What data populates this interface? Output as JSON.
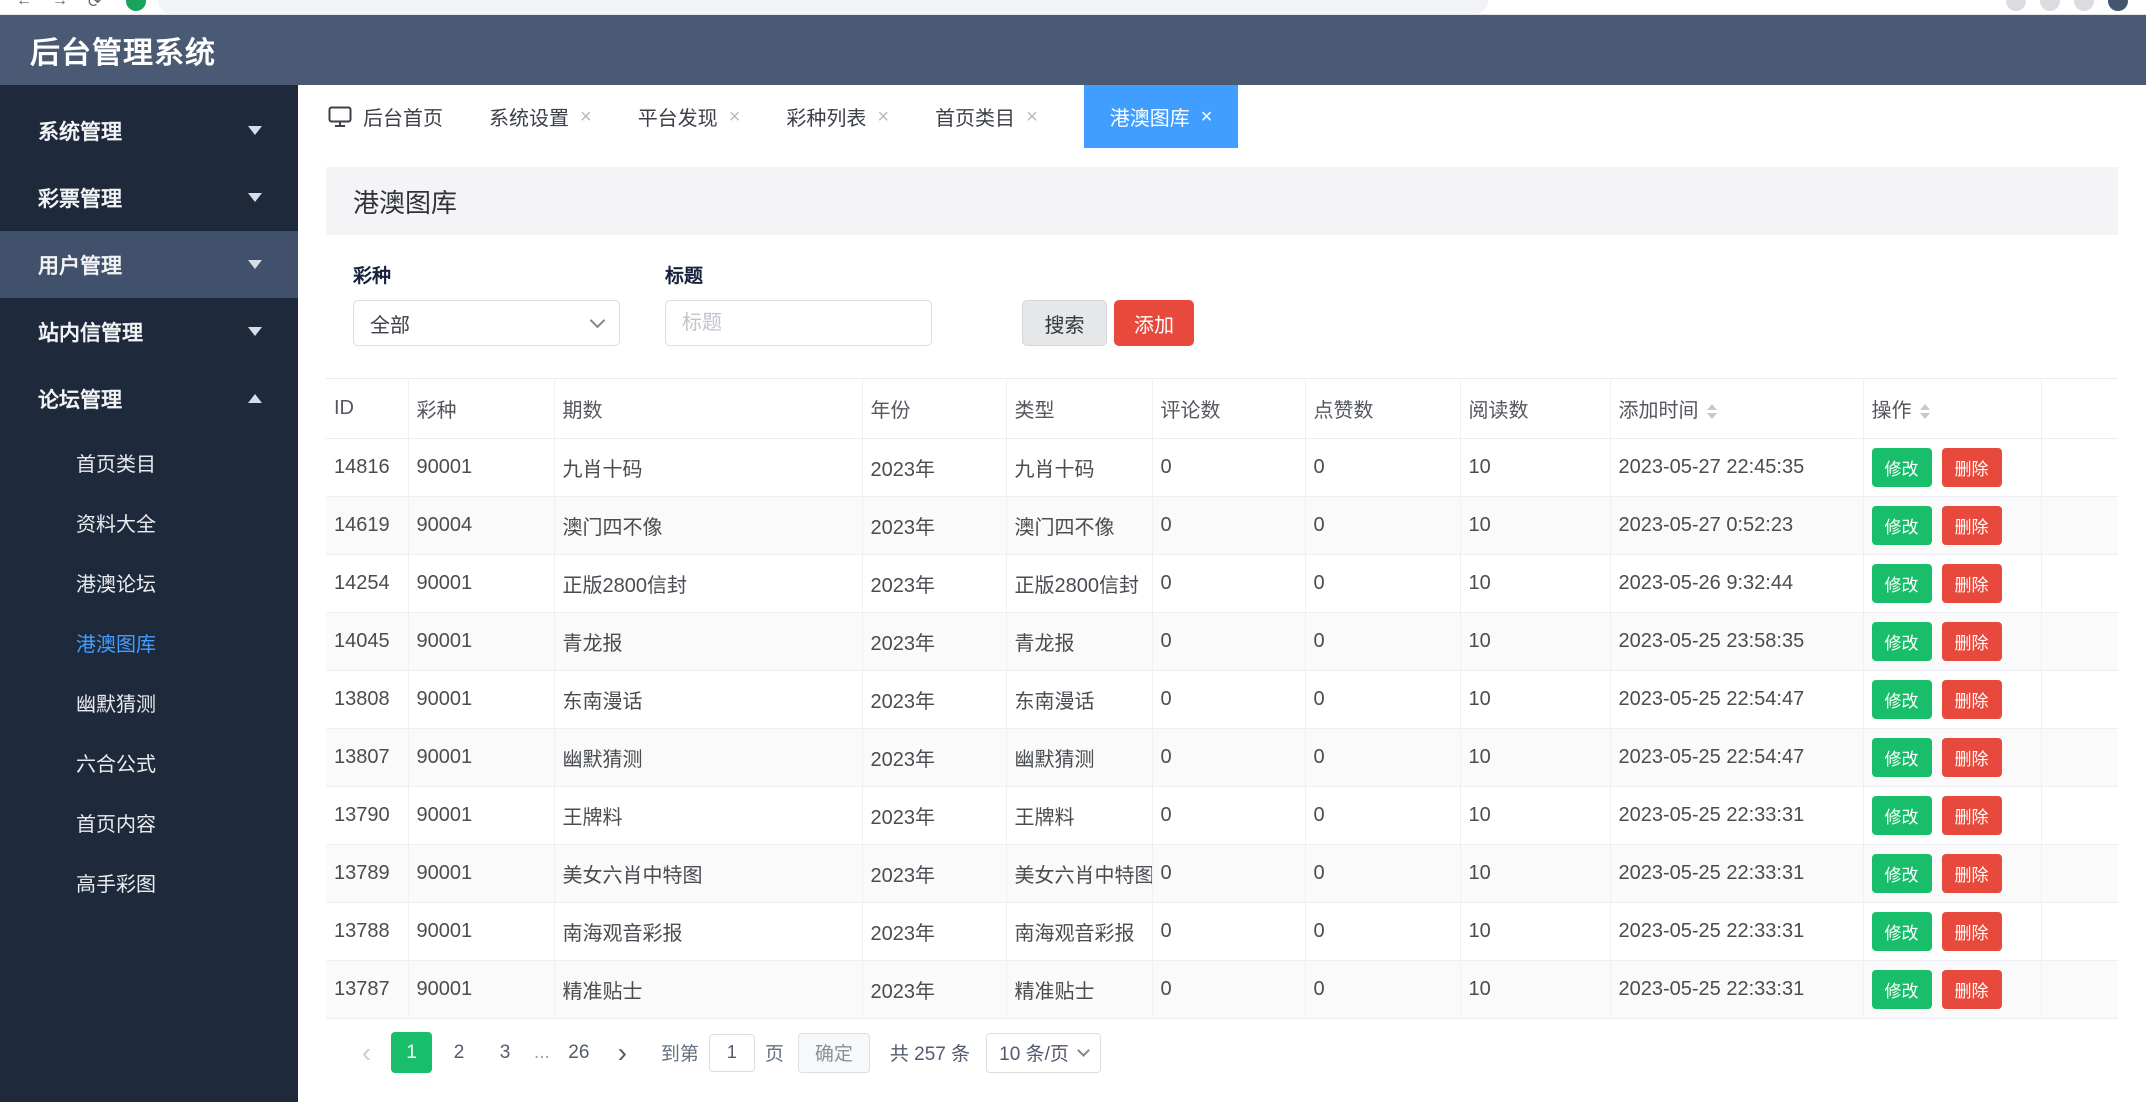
{
  "colors": {
    "accent_blue": "#409eff",
    "green": "#19be6b",
    "red": "#e74a3c",
    "sidebar_bg": "#1e2a3c",
    "header_bg": "#4a5a74"
  },
  "icons": {
    "close": "×"
  },
  "header": {
    "title": "后台管理系统"
  },
  "sidebar": {
    "items": [
      {
        "label": "系统管理"
      },
      {
        "label": "彩票管理"
      },
      {
        "label": "用户管理"
      },
      {
        "label": "站内信管理"
      },
      {
        "label": "论坛管理"
      }
    ],
    "submenu": [
      {
        "label": "首页类目"
      },
      {
        "label": "资料大全"
      },
      {
        "label": "港澳论坛"
      },
      {
        "label": "港澳图库"
      },
      {
        "label": "幽默猜测"
      },
      {
        "label": "六合公式"
      },
      {
        "label": "首页内容"
      },
      {
        "label": "高手彩图"
      }
    ]
  },
  "tabs": [
    {
      "label": "后台首页"
    },
    {
      "label": "系统设置"
    },
    {
      "label": "平台发现"
    },
    {
      "label": "彩种列表"
    },
    {
      "label": "首页类目"
    },
    {
      "label": "港澳图库"
    }
  ],
  "panel": {
    "title": "港澳图库"
  },
  "filter": {
    "lottery_label": "彩种",
    "lottery_value": "全部",
    "title_label": "标题",
    "title_placeholder": "标题",
    "search_button": "搜索",
    "add_button": "添加"
  },
  "table": {
    "columns": [
      "ID",
      "彩种",
      "期数",
      "年份",
      "类型",
      "评论数",
      "点赞数",
      "阅读数",
      "添加时间",
      "操作"
    ],
    "actions": {
      "edit": "修改",
      "delete": "删除"
    },
    "rows": [
      {
        "id": "14816",
        "lottery": "90001",
        "issue": "九肖十码",
        "year": "2023年",
        "type": "九肖十码",
        "comments": "0",
        "likes": "0",
        "reads": "10",
        "time": "2023-05-27 22:45:35"
      },
      {
        "id": "14619",
        "lottery": "90004",
        "issue": "澳门四不像",
        "year": "2023年",
        "type": "澳门四不像",
        "comments": "0",
        "likes": "0",
        "reads": "10",
        "time": "2023-05-27 0:52:23"
      },
      {
        "id": "14254",
        "lottery": "90001",
        "issue": "正版2800信封",
        "year": "2023年",
        "type": "正版2800信封",
        "comments": "0",
        "likes": "0",
        "reads": "10",
        "time": "2023-05-26 9:32:44"
      },
      {
        "id": "14045",
        "lottery": "90001",
        "issue": "青龙报",
        "year": "2023年",
        "type": "青龙报",
        "comments": "0",
        "likes": "0",
        "reads": "10",
        "time": "2023-05-25 23:58:35"
      },
      {
        "id": "13808",
        "lottery": "90001",
        "issue": "东南漫话",
        "year": "2023年",
        "type": "东南漫话",
        "comments": "0",
        "likes": "0",
        "reads": "10",
        "time": "2023-05-25 22:54:47"
      },
      {
        "id": "13807",
        "lottery": "90001",
        "issue": "幽默猜测",
        "year": "2023年",
        "type": "幽默猜测",
        "comments": "0",
        "likes": "0",
        "reads": "10",
        "time": "2023-05-25 22:54:47"
      },
      {
        "id": "13790",
        "lottery": "90001",
        "issue": "王牌料",
        "year": "2023年",
        "type": "王牌料",
        "comments": "0",
        "likes": "0",
        "reads": "10",
        "time": "2023-05-25 22:33:31"
      },
      {
        "id": "13789",
        "lottery": "90001",
        "issue": "美女六肖中特图",
        "year": "2023年",
        "type": "美女六肖中特图",
        "comments": "0",
        "likes": "0",
        "reads": "10",
        "time": "2023-05-25 22:33:31"
      },
      {
        "id": "13788",
        "lottery": "90001",
        "issue": "南海观音彩报",
        "year": "2023年",
        "type": "南海观音彩报",
        "comments": "0",
        "likes": "0",
        "reads": "10",
        "time": "2023-05-25 22:33:31"
      },
      {
        "id": "13787",
        "lottery": "90001",
        "issue": "精准贴士",
        "year": "2023年",
        "type": "精准贴士",
        "comments": "0",
        "likes": "0",
        "reads": "10",
        "time": "2023-05-25 22:33:31"
      }
    ]
  },
  "pagination": {
    "prev": "‹",
    "next": "›",
    "pages": [
      "1",
      "2",
      "3",
      "...",
      "26"
    ],
    "active_page": "1",
    "goto_label": "到第",
    "goto_value": "1",
    "page_unit": "页",
    "confirm": "确定",
    "total": "共 257 条",
    "size": "10 条/页"
  }
}
